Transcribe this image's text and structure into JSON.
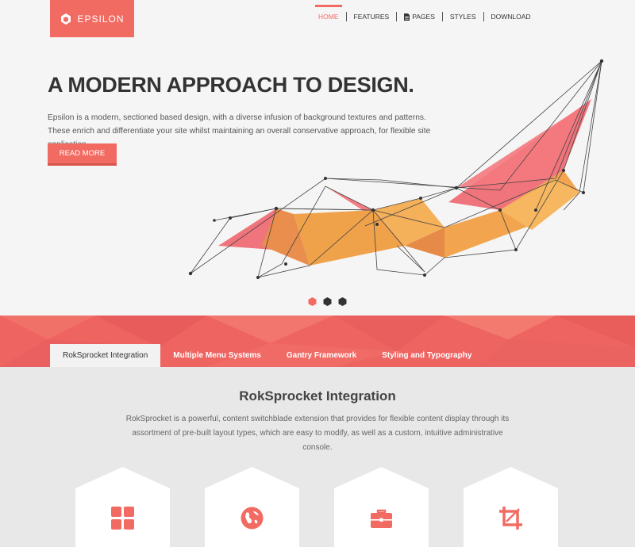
{
  "brand": {
    "name": "EPSILON",
    "accent": "#f26b63"
  },
  "nav": {
    "items": [
      {
        "label": "HOME",
        "active": true
      },
      {
        "label": "FEATURES"
      },
      {
        "label": "PAGES",
        "icon": "document-icon"
      },
      {
        "label": "STYLES"
      },
      {
        "label": "DOWNLOAD"
      }
    ]
  },
  "hero": {
    "title": "A MODERN APPROACH TO DESIGN.",
    "text": "Epsilon is a modern, sectioned based design, with a diverse infusion of background textures and patterns. These enrich and differentiate your site whilst maintaining an overall conservative approach, for flexible site application.",
    "button": "READ MORE",
    "slides_total": 3,
    "slide_active": 1
  },
  "tabs": [
    {
      "label": "RokSprocket Integration",
      "active": true
    },
    {
      "label": "Multiple Menu Systems"
    },
    {
      "label": "Gantry Framework"
    },
    {
      "label": "Styling and Typography"
    }
  ],
  "section": {
    "title": "RokSprocket Integration",
    "text": "RokSprocket is a powerful, content switchblade extension that provides for flexible content display through its assortment of pre-built layout types, which are easy to modify, as well as a custom, intuitive administrative console."
  },
  "features": [
    {
      "icon": "grid-icon"
    },
    {
      "icon": "globe-icon"
    },
    {
      "icon": "briefcase-icon"
    },
    {
      "icon": "crop-icon"
    }
  ]
}
